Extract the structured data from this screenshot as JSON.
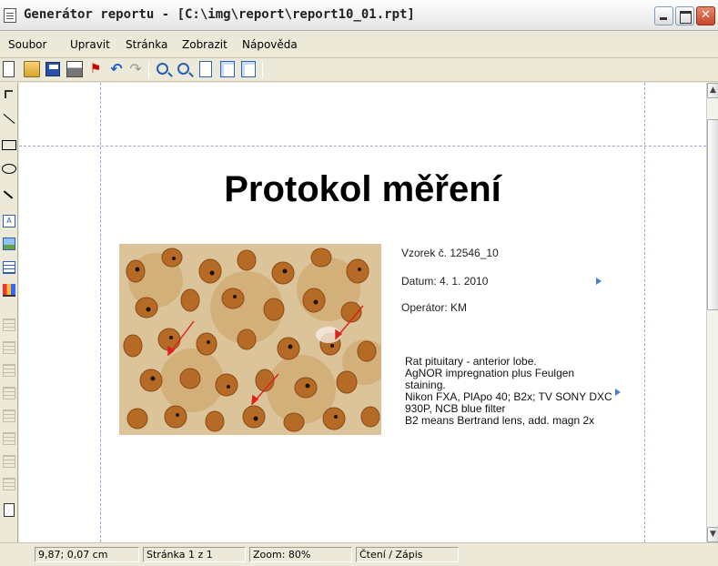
{
  "window": {
    "title": "Generátor reportu - [C:\\img\\report\\report10_01.rpt]",
    "icon": "document-icon",
    "controls": [
      "minimize-icon",
      "maximize-icon",
      "close-icon"
    ]
  },
  "menu": {
    "items": [
      "Soubor",
      "Upravit",
      "Stránka",
      "Zobrazit",
      "Nápověda"
    ]
  },
  "toolbar": {
    "icons": [
      "new-document-icon",
      "open-folder-icon",
      "save-icon",
      "print-icon",
      "pdf-export-icon",
      "undo-icon",
      "redo-icon",
      "zoom-in-icon",
      "zoom-out-icon",
      "page-icon",
      "page-setup-icon",
      "page-settings-icon"
    ]
  },
  "left_toolbar": {
    "icons": [
      "select-arrow-icon",
      "line-icon",
      "rectangle-icon",
      "ellipse-icon",
      "arrow-icon",
      "text-icon",
      "image-icon",
      "table-icon",
      "chart-icon",
      "align-left-icon",
      "center-vertical-icon",
      "align-right-icon",
      "align-top-icon",
      "center-horizontal-icon",
      "align-bottom-icon",
      "distribute-horizontal-icon",
      "distribute-vertical-icon",
      "page-icon"
    ]
  },
  "document": {
    "title": "Protokol měření",
    "sample": "Vzorek č. 12546_10",
    "date": "Datum: 4. 1. 2010",
    "operator": "Operátor: KM",
    "description": [
      "Rat pituitary - anterior lobe.",
      "AgNOR impregnation plus Feulgen",
      "staining.",
      "Nikon FXA, PlApo 40; B2x; TV SONY DXC",
      "930P, NCB blue filter",
      "B2 means Bertrand lens, add. magn 2x"
    ]
  },
  "statusbar": {
    "position": "9,87; 0,07 cm",
    "page": "Stránka 1 z 1",
    "zoom": "Zoom: 80%",
    "mode": "Čtení / Zápis"
  },
  "colors": {
    "guide": "#9fa6d6",
    "arrows": "#e0201a",
    "chrome": "#ece9d8"
  }
}
